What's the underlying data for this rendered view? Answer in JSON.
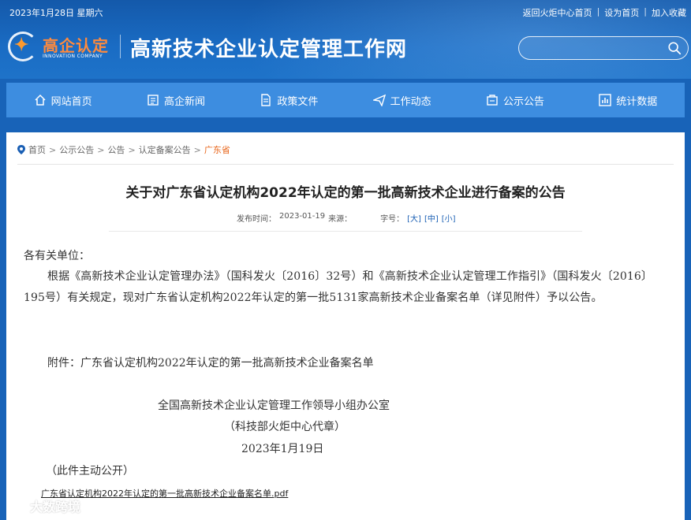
{
  "topbar": {
    "date": "2023年1月28日 星期六",
    "links": [
      "返回火炬中心首页",
      "设为首页",
      "加入收藏"
    ]
  },
  "logo": {
    "cn": "高企认定",
    "en": "INNOVATION COMPANY"
  },
  "site_title": "高新技术企业认定管理工作网",
  "search": {
    "value": ""
  },
  "nav": [
    {
      "label": "网站首页",
      "icon": "home-icon"
    },
    {
      "label": "高企新闻",
      "icon": "news-icon"
    },
    {
      "label": "政策文件",
      "icon": "document-icon"
    },
    {
      "label": "工作动态",
      "icon": "send-icon"
    },
    {
      "label": "公示公告",
      "icon": "notice-icon"
    },
    {
      "label": "统计数据",
      "icon": "chart-icon"
    }
  ],
  "breadcrumb": [
    "首页",
    "公示公告",
    "公告",
    "认定备案公告",
    "广东省"
  ],
  "article": {
    "title": "关于对广东省认定机构2022年认定的第一批高新技术企业进行备案的公告",
    "publish_label": "发布时间：",
    "publish_date": "2023-01-19",
    "source_label": "来源：",
    "font_label": "字号：",
    "font_sizes": [
      "[大]",
      "[中]",
      "[小]"
    ],
    "salutation": "各有关单位：",
    "paragraph": "根据《高新技术企业认定管理办法》（国科发火〔2016〕32号）和《高新技术企业认定管理工作指引》（国科发火〔2016〕195号）有关规定，现对广东省认定机构2022年认定的第一批5131家高新技术企业备案名单（详见附件）予以公告。",
    "attachment_note": "附件：广东省认定机构2022年认定的第一批高新技术企业备案名单",
    "signature_org": "全国高新技术企业认定管理工作领导小组办公室",
    "signature_sub": "（科技部火炬中心代章）",
    "signature_date": "2023年1月19日",
    "disclosure": "（此件主动公开）",
    "attachment_file": "广东省认定机构2022年认定的第一批高新技术企业备案名单.pdf"
  },
  "watermark": "大数跨境",
  "colors": {
    "header_blue": "#1a6cc4",
    "nav_blue": "#3d8de0",
    "accent_orange": "#e8651a",
    "link_blue": "#1a5fb4"
  }
}
